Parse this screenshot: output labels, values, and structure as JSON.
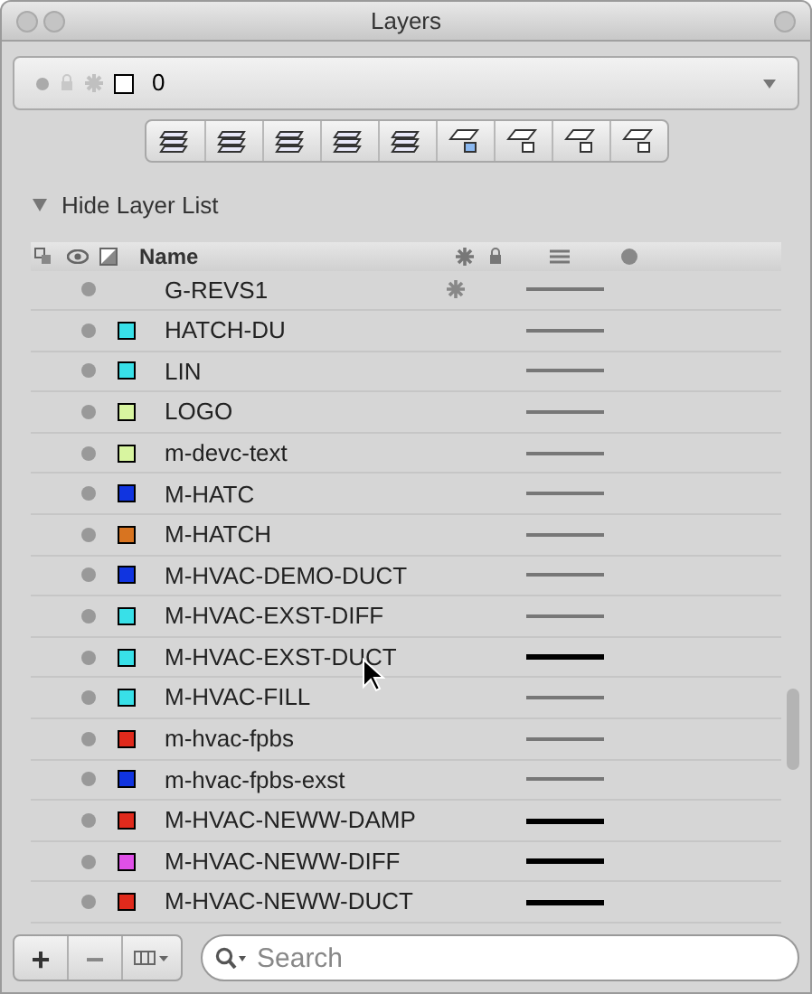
{
  "window": {
    "title": "Layers"
  },
  "current_layer": {
    "name": "0",
    "color": "#ffffff"
  },
  "toolbar": {
    "buttons": [
      {
        "kind": "stack"
      },
      {
        "kind": "stack"
      },
      {
        "kind": "stack"
      },
      {
        "kind": "stack"
      },
      {
        "kind": "stack"
      },
      {
        "kind": "sheet"
      },
      {
        "kind": "sheet"
      },
      {
        "kind": "sheet"
      },
      {
        "kind": "sheet"
      }
    ]
  },
  "section": {
    "label": "Hide Layer List",
    "expanded": true
  },
  "table": {
    "columns": [
      {
        "label": "Name"
      }
    ],
    "rows": [
      {
        "name": "G-REVS1",
        "frozen": true,
        "heavy_line": false
      },
      {
        "name": "HATCH-DU",
        "color": "#38e0e8",
        "frozen": false,
        "heavy_line": false
      },
      {
        "name": "LIN",
        "color": "#38e0e8",
        "frozen": false,
        "heavy_line": false
      },
      {
        "name": "LOGO",
        "color": "#d8f5a0",
        "frozen": false,
        "heavy_line": false
      },
      {
        "name": "m-devc-text",
        "color": "#d8f5a0",
        "frozen": false,
        "heavy_line": false
      },
      {
        "name": "M-HATC",
        "color": "#1034e0",
        "frozen": false,
        "heavy_line": false
      },
      {
        "name": "M-HATCH",
        "color": "#d87420",
        "frozen": false,
        "heavy_line": false
      },
      {
        "name": "M-HVAC-DEMO-DUCT",
        "color": "#1034e0",
        "frozen": false,
        "heavy_line": false
      },
      {
        "name": "M-HVAC-EXST-DIFF",
        "color": "#38e0e8",
        "frozen": false,
        "heavy_line": false
      },
      {
        "name": "M-HVAC-EXST-DUCT",
        "color": "#38e0e8",
        "frozen": false,
        "heavy_line": true
      },
      {
        "name": "M-HVAC-FILL",
        "color": "#38e0e8",
        "frozen": false,
        "heavy_line": false
      },
      {
        "name": "m-hvac-fpbs",
        "color": "#e02a1c",
        "frozen": false,
        "heavy_line": false
      },
      {
        "name": "m-hvac-fpbs-exst",
        "color": "#1034e0",
        "frozen": false,
        "heavy_line": false
      },
      {
        "name": "M-HVAC-NEWW-DAMP",
        "color": "#e02a1c",
        "frozen": false,
        "heavy_line": true
      },
      {
        "name": "M-HVAC-NEWW-DIFF",
        "color": "#e050e8",
        "frozen": false,
        "heavy_line": true
      },
      {
        "name": "M-HVAC-NEWW-DUCT",
        "color": "#e02a1c",
        "frozen": false,
        "heavy_line": true
      }
    ]
  },
  "bottom_bar": {
    "buttons": [
      {
        "label": "+",
        "disabled": false
      },
      {
        "label": "−",
        "disabled": true
      }
    ],
    "search": {
      "placeholder": "Search"
    }
  }
}
